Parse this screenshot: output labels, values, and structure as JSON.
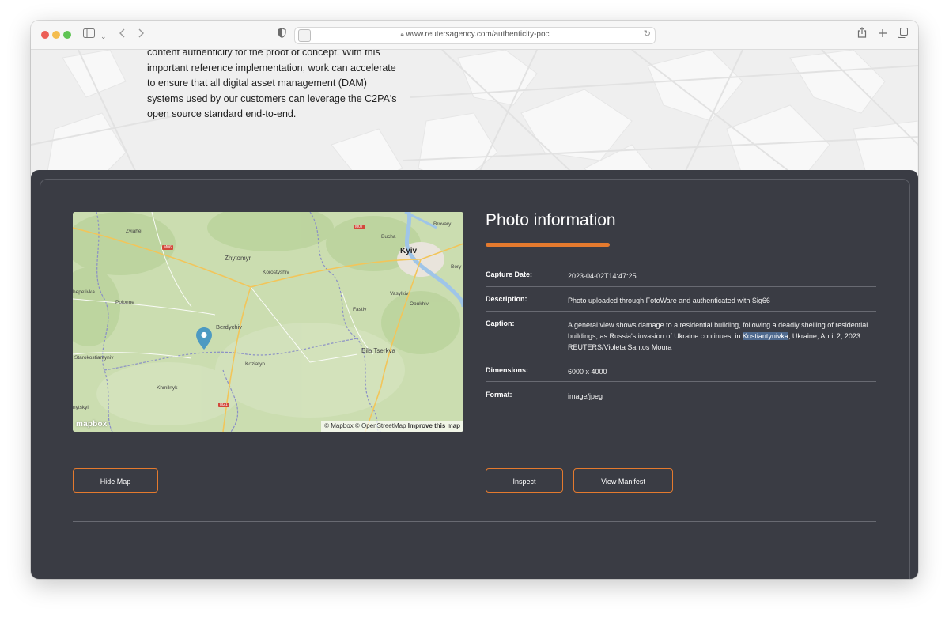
{
  "browser": {
    "url": "www.reutersagency.com/authenticity-poc",
    "icons": [
      "sidebar-icon",
      "chevron-down-icon",
      "back-icon",
      "forward-icon",
      "shield-icon",
      "share-icon",
      "plus-icon",
      "tabs-icon",
      "reload-icon",
      "lock-icon"
    ]
  },
  "hero": {
    "paragraph": "content authenticity for the proof of concept. With this important reference implementation, work can accelerate to ensure that all digital asset management (DAM) systems used by our customers can leverage the C2PA's open source standard end-to-end."
  },
  "map": {
    "places": {
      "kyiv": "Kyiv",
      "zviahel": "Zviahel",
      "zhytomyr": "Zhytomyr",
      "korostyshiv": "Korostyshiv",
      "bucha": "Bucha",
      "brovary": "Brovary",
      "bor": "Bory",
      "shepetivka": "hepetivka",
      "polonne": "Polonne",
      "berdychiv": "Berdychiv",
      "fastiv": "Fastiv",
      "vasylkiv": "Vasylkiv",
      "obukhiv": "Obukhiv",
      "bila_tserkva": "Bila Tserkva",
      "starokostiantyniv": "Starokostiantyniv",
      "koziatyn": "Koziatyn",
      "khmilnyk": "Khmilnyk",
      "nytskyi": "nytskyi"
    },
    "roads": {
      "m06": "M06",
      "m07": "M07",
      "m21": "M21"
    },
    "attribution": "© Mapbox © OpenStreetMap",
    "improve": "Improve this map",
    "logo": "mapbox"
  },
  "info": {
    "title": "Photo information",
    "accent": "#e47a2e",
    "rows": [
      {
        "key": "Capture Date:",
        "value": "2023-04-02T14:47:25"
      },
      {
        "key": "Description:",
        "value": "Photo uploaded through FotoWare and authenticated with Sig66"
      },
      {
        "key": "Caption:",
        "value_pre": "A general view shows damage to a residential building, following a deadly shelling of residential buildings, as Russia's invasion of Ukraine continues, in ",
        "value_highlight": "Kostiantynivka",
        "value_post": ", Ukraine, April 2, 2023. REUTERS/Violeta Santos Moura"
      },
      {
        "key": "Dimensions:",
        "value": "6000 x 4000"
      },
      {
        "key": "Format:",
        "value": "image/jpeg"
      }
    ]
  },
  "buttons": {
    "hide_map": "Hide Map",
    "inspect": "Inspect",
    "view_manifest": "View Manifest"
  }
}
